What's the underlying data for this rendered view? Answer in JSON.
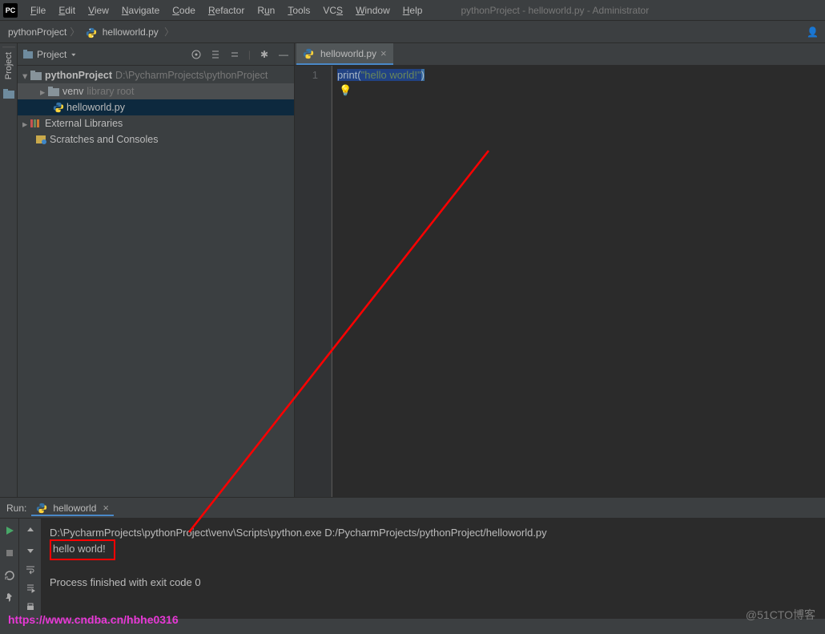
{
  "app_icon_text": "PC",
  "title_hint": "pythonProject - helloworld.py - Administrator",
  "menus": {
    "file": "File",
    "edit": "Edit",
    "view": "View",
    "navigate": "Navigate",
    "code": "Code",
    "refactor": "Refactor",
    "run": "Run",
    "tools": "Tools",
    "vcs": "VCS",
    "window": "Window",
    "help": "Help"
  },
  "breadcrumb": {
    "project": "pythonProject",
    "file": "helloworld.py"
  },
  "sidebar_tab": "Project",
  "project_pane": {
    "title": "Project"
  },
  "tree": {
    "root": {
      "name": "pythonProject",
      "path": "D:\\PycharmProjects\\pythonProject"
    },
    "venv": {
      "name": "venv",
      "hint": "library root"
    },
    "file": "helloworld.py",
    "ext_libs": "External Libraries",
    "scratches": "Scratches and Consoles"
  },
  "editor": {
    "tab_name": "helloworld.py",
    "line_number": "1",
    "token_print": "print",
    "token_open": "(",
    "token_string": "\"hello world!\"",
    "token_close": ")"
  },
  "run": {
    "label": "Run:",
    "config_name": "helloworld",
    "cmd_line": "D:\\PycharmProjects\\pythonProject\\venv\\Scripts\\python.exe D:/PycharmProjects/pythonProject/helloworld.py",
    "output_line": "hello world!",
    "exit_line": "Process finished with exit code 0"
  },
  "watermark_left": "https://www.cndba.cn/hbhe0316",
  "watermark_right": "@51CTO博客"
}
